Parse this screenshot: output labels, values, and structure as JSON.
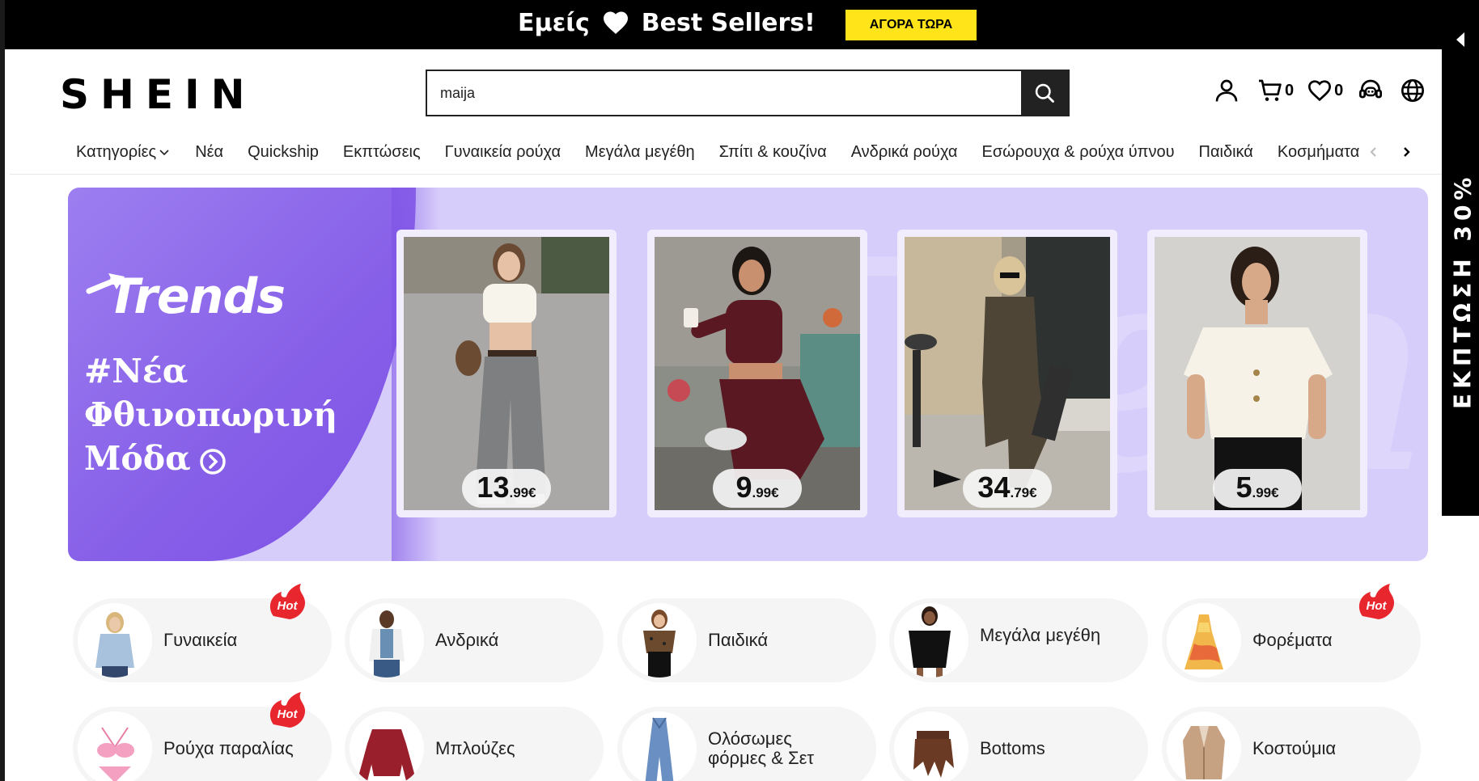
{
  "promo": {
    "text_left": "Εμείς",
    "text_right": "Best Sellers!",
    "heart_icon": "heart-icon",
    "button": "ΑΓΟΡΑ ΤΩΡΑ",
    "button_color": "#ffe41a"
  },
  "header": {
    "logo": "SHEIN",
    "search_value": "maija",
    "cart_count": "0",
    "wishlist_count": "0"
  },
  "nav": {
    "items": [
      "Κατηγορίες",
      "Νέα",
      "Quickship",
      "Εκπτώσεις",
      "Γυναικεία ρούχα",
      "Μεγάλα μεγέθη",
      "Σπίτι & κουζίνα",
      "Ανδρικά ρούχα",
      "Εσώρουχα & ρούχα ύπνου",
      "Παιδικά",
      "Κοσμήματα & αξ"
    ]
  },
  "side_banner": {
    "text": "ΕΚΠΤΩΣΗ 30%"
  },
  "banner": {
    "logo": "Trends",
    "tagline_1": "#Νέα",
    "tagline_2": "Φθινοπωρινή",
    "tagline_3": "Μόδα",
    "accent": "#8760e8",
    "products": [
      {
        "price_int": "13",
        "price_dec": ".99€"
      },
      {
        "price_int": "9",
        "price_dec": ".99€"
      },
      {
        "price_int": "34",
        "price_dec": ".79€"
      },
      {
        "price_int": "5",
        "price_dec": ".99€"
      }
    ]
  },
  "categories": [
    {
      "label": "Γυναικεία",
      "hot": true
    },
    {
      "label": "Ανδρικά",
      "hot": false
    },
    {
      "label": "Παιδικά",
      "hot": false
    },
    {
      "label": "Μεγάλα μεγέθη",
      "hot": false
    },
    {
      "label": "Φορέματα",
      "hot": true
    },
    {
      "label": "Ρούχα παραλίας",
      "hot": true
    },
    {
      "label": "Μπλούζες",
      "hot": false
    },
    {
      "label": "Ολόσωμες φόρμες & Σετ",
      "hot": false
    },
    {
      "label": "Bottoms",
      "hot": false
    },
    {
      "label": "Κοστούμια",
      "hot": false
    }
  ],
  "hot_label": "Hot",
  "hot_color": "#e8262e"
}
